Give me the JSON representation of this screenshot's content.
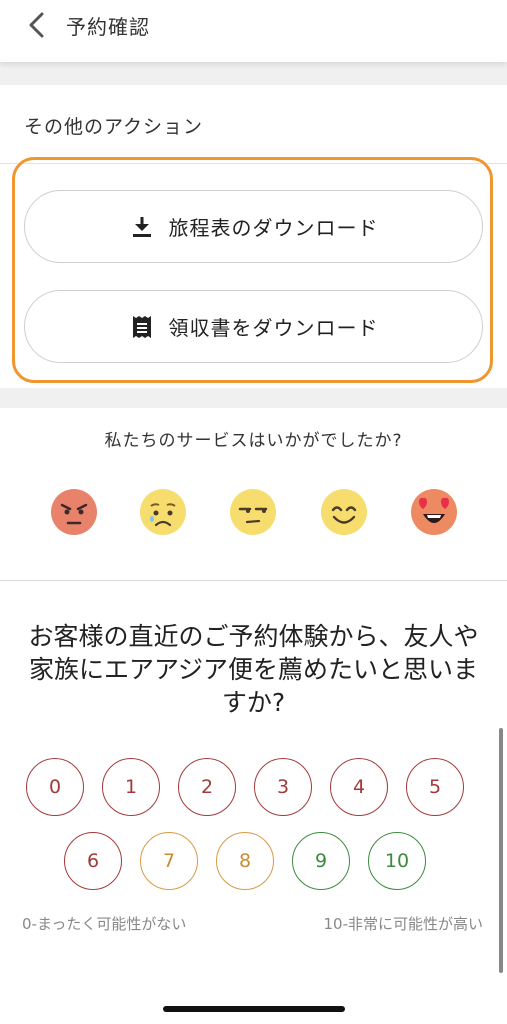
{
  "header": {
    "title": "予約確認",
    "back_icon": "chevron-left-icon"
  },
  "actions": {
    "title": "その他のアクション",
    "items": [
      {
        "label": "旅程表のダウンロード",
        "icon": "download-icon"
      },
      {
        "label": "領収書をダウンロード",
        "icon": "receipt-icon"
      }
    ],
    "highlight_color": "#f0962e"
  },
  "feedback": {
    "question": "私たちのサービスはいかがでしたか?",
    "emojis": [
      "angry-face-icon",
      "sad-face-icon",
      "unamused-face-icon",
      "smiling-face-icon",
      "heart-eyes-face-icon"
    ]
  },
  "nps": {
    "question": "お客様の直近のご予約体験から、友人や家族にエアアジア便を薦めたいと思いますか?",
    "scores": [
      "0",
      "1",
      "2",
      "3",
      "4",
      "5",
      "6",
      "7",
      "8",
      "9",
      "10"
    ],
    "low_label": "0-まったく可能性がない",
    "high_label": "10-非常に可能性が高い",
    "colors": {
      "detractor": "#a33a3a",
      "passive": "#d99a46",
      "promoter": "#3d8a3d"
    }
  }
}
